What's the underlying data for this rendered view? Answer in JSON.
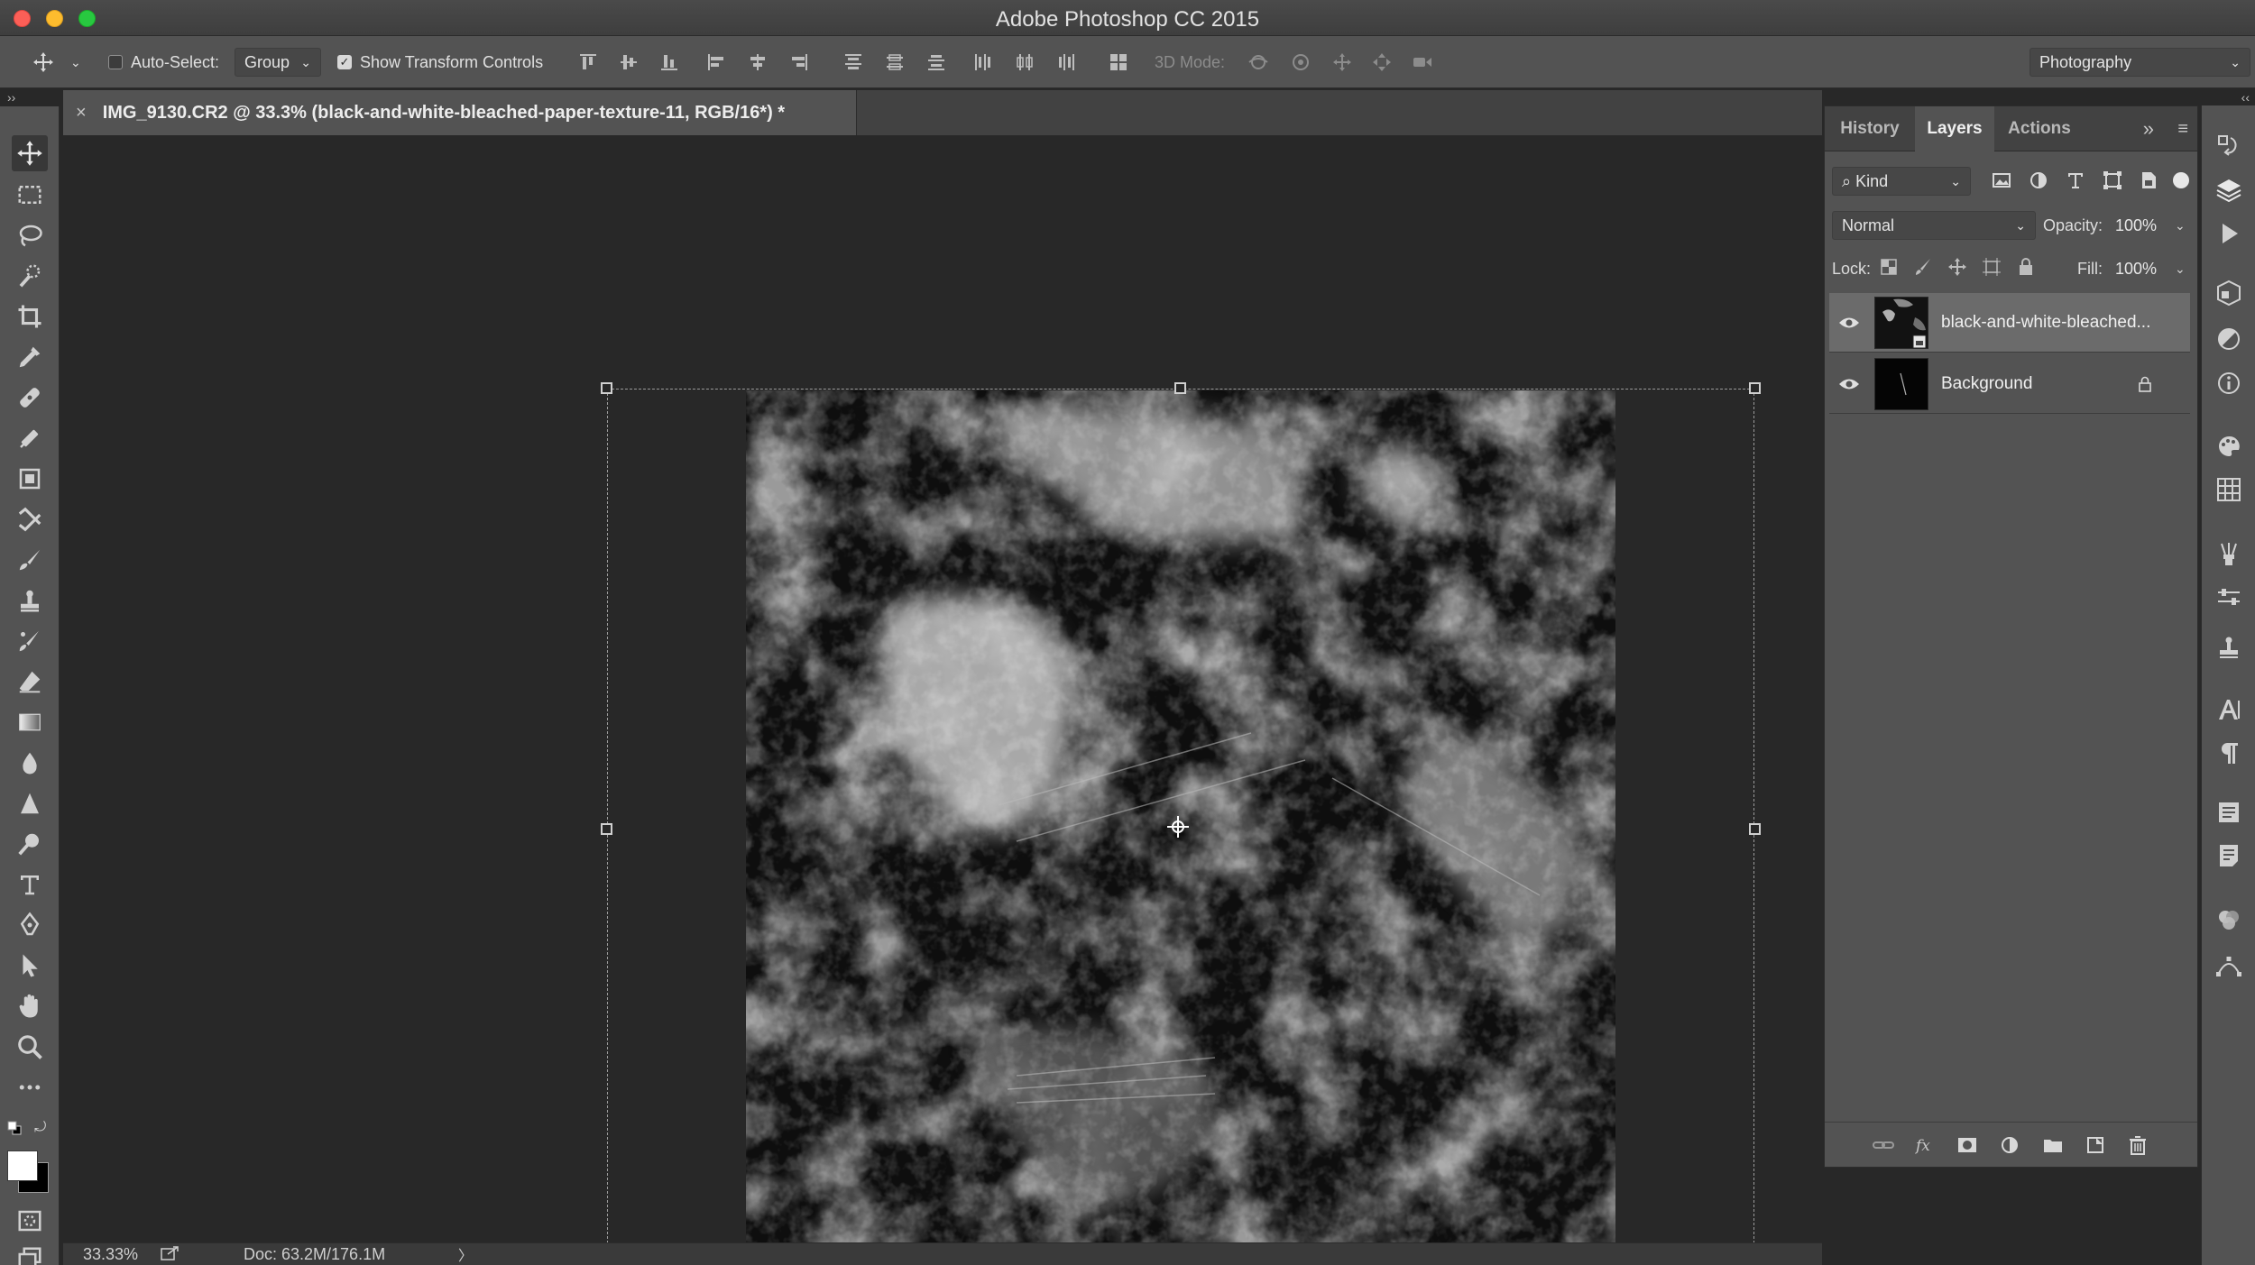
{
  "window": {
    "title": "Adobe Photoshop CC 2015",
    "traffic_lights": [
      "close",
      "minimize",
      "maximize"
    ]
  },
  "options_bar": {
    "move_tool_icon": "move-icon",
    "auto_select": {
      "label": "Auto-Select:",
      "checked": false,
      "target": "Group"
    },
    "show_transform_controls": {
      "label": "Show Transform Controls",
      "checked": true
    },
    "three_d_mode_label": "3D Mode:",
    "workspace": "Photography"
  },
  "document": {
    "tab_title": "IMG_9130.CR2 @ 33.3% (black-and-white-bleached-paper-texture-11, RGB/16*) *",
    "close_glyph": "×"
  },
  "status_bar": {
    "zoom": "33.33%",
    "doc_size": "Doc: 63.2M/176.1M",
    "arrow": "〉"
  },
  "panel": {
    "tabs": [
      {
        "label": "History",
        "active": false
      },
      {
        "label": "Layers",
        "active": true
      },
      {
        "label": "Actions",
        "active": false
      }
    ],
    "filter_kind": "Kind",
    "blend_mode": "Normal",
    "opacity_label": "Opacity:",
    "opacity_value": "100%",
    "lock_label": "Lock:",
    "fill_label": "Fill:",
    "fill_value": "100%",
    "layers": [
      {
        "name": "black-and-white-bleached...",
        "visible": true,
        "selected": true,
        "smart_object": true,
        "locked": false
      },
      {
        "name": "Background",
        "visible": true,
        "selected": false,
        "smart_object": false,
        "locked": true
      }
    ]
  },
  "colors": {
    "ui_panel": "#535353",
    "ui_dark": "#282828",
    "foreground_swatch": "#ffffff",
    "background_swatch": "#000000",
    "selected_layer": "#6b6b6b"
  }
}
